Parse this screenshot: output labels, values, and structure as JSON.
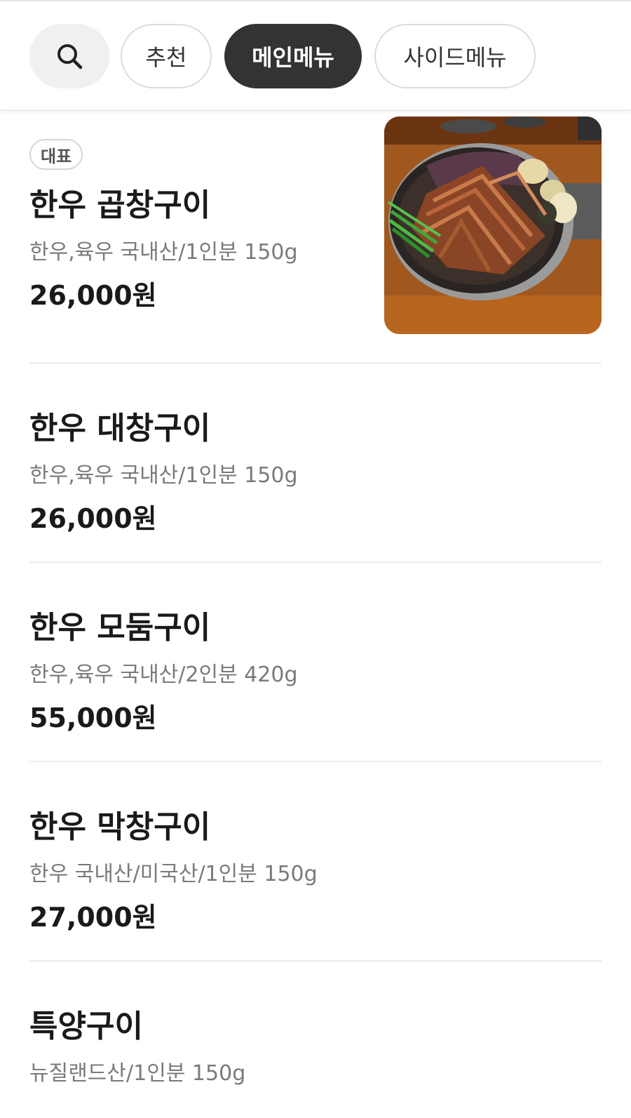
{
  "search": {
    "icon": "search-icon"
  },
  "tabs": [
    {
      "label": "추천",
      "active": false
    },
    {
      "label": "메인메뉴",
      "active": true
    },
    {
      "label": "사이드메뉴",
      "active": false
    }
  ],
  "menu": {
    "items": [
      {
        "badge": "대표",
        "name": "한우 곱창구이",
        "desc": "한우,육우 국내산/1인분 150g",
        "price": "26,000원",
        "has_photo": true
      },
      {
        "name": "한우 대창구이",
        "desc": "한우,육우 국내산/1인분 150g",
        "price": "26,000원"
      },
      {
        "name": "한우 모둠구이",
        "desc": "한우,육우 국내산/2인분 420g",
        "price": "55,000원"
      },
      {
        "name": "한우 막창구이",
        "desc": "한우 국내산/미국산/1인분 150g",
        "price": "27,000원"
      },
      {
        "name": "특양구이",
        "desc": "뉴질랜드산/1인분 150g"
      }
    ]
  },
  "colors": {
    "active_tab": "#333333",
    "tab_border": "#dcdcdc",
    "desc_text": "#7a7a7a",
    "divider": "#ececec"
  }
}
